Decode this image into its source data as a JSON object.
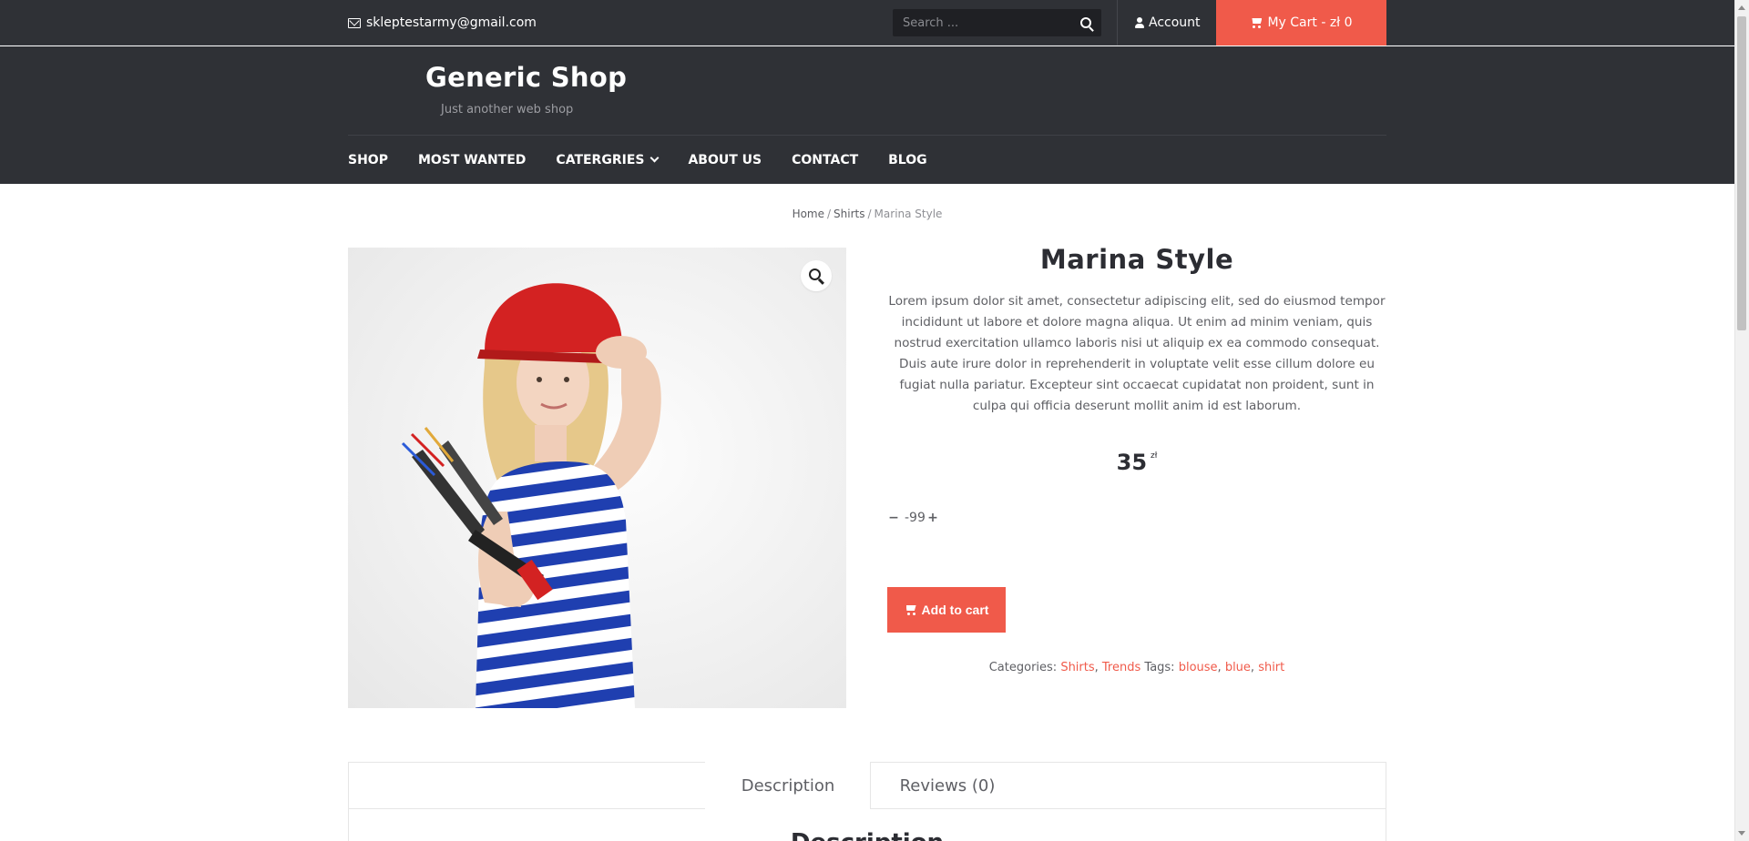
{
  "topbar": {
    "email": "skleptestarmy@gmail.com",
    "search_placeholder": "Search ...",
    "account_label": "Account",
    "cart_label": "My Cart - zł 0"
  },
  "header": {
    "site_title": "Generic Shop",
    "tagline": "Just another web shop"
  },
  "nav": {
    "items": [
      {
        "label": "SHOP"
      },
      {
        "label": "MOST WANTED"
      },
      {
        "label": "CATERGRIES"
      },
      {
        "label": "ABOUT US"
      },
      {
        "label": "CONTACT"
      },
      {
        "label": "BLOG"
      }
    ]
  },
  "breadcrumb": {
    "home": "Home",
    "category": "Shirts",
    "current": "Marina Style",
    "separator": "/"
  },
  "product": {
    "title": "Marina Style",
    "description": "Lorem ipsum dolor sit amet, consectetur adipiscing elit, sed do eiusmod tempor incididunt ut labore et dolore magna aliqua. Ut enim ad minim veniam, quis nostrud exercitation ullamco laboris nisi ut aliquip ex ea commodo consequat. Duis aute irure dolor in reprehenderit in voluptate velit esse cillum dolore eu fugiat nulla pariatur. Excepteur sint occaecat cupidatat non proident, sunt in culpa qui officia deserunt mollit anim id est laborum.",
    "price": "35",
    "currency": "zł",
    "quantity": "-99",
    "add_to_cart_label": "Add to cart",
    "categories_label": "Categories:",
    "categories": [
      "Shirts",
      "Trends"
    ],
    "tags_label": "Tags:",
    "tags": [
      "blouse",
      "blue",
      "shirt"
    ]
  },
  "tabs": {
    "description_label": "Description",
    "reviews_label": "Reviews (0)",
    "content_heading": "Description"
  },
  "colors": {
    "accent": "#f05a4a",
    "header_bg": "#2f3136"
  },
  "icons": {
    "email": "envelope-icon",
    "search": "search-icon",
    "account": "user-icon",
    "cart": "shopping-cart-icon",
    "dropdown": "chevron-down-icon",
    "zoom": "magnifier-icon"
  }
}
